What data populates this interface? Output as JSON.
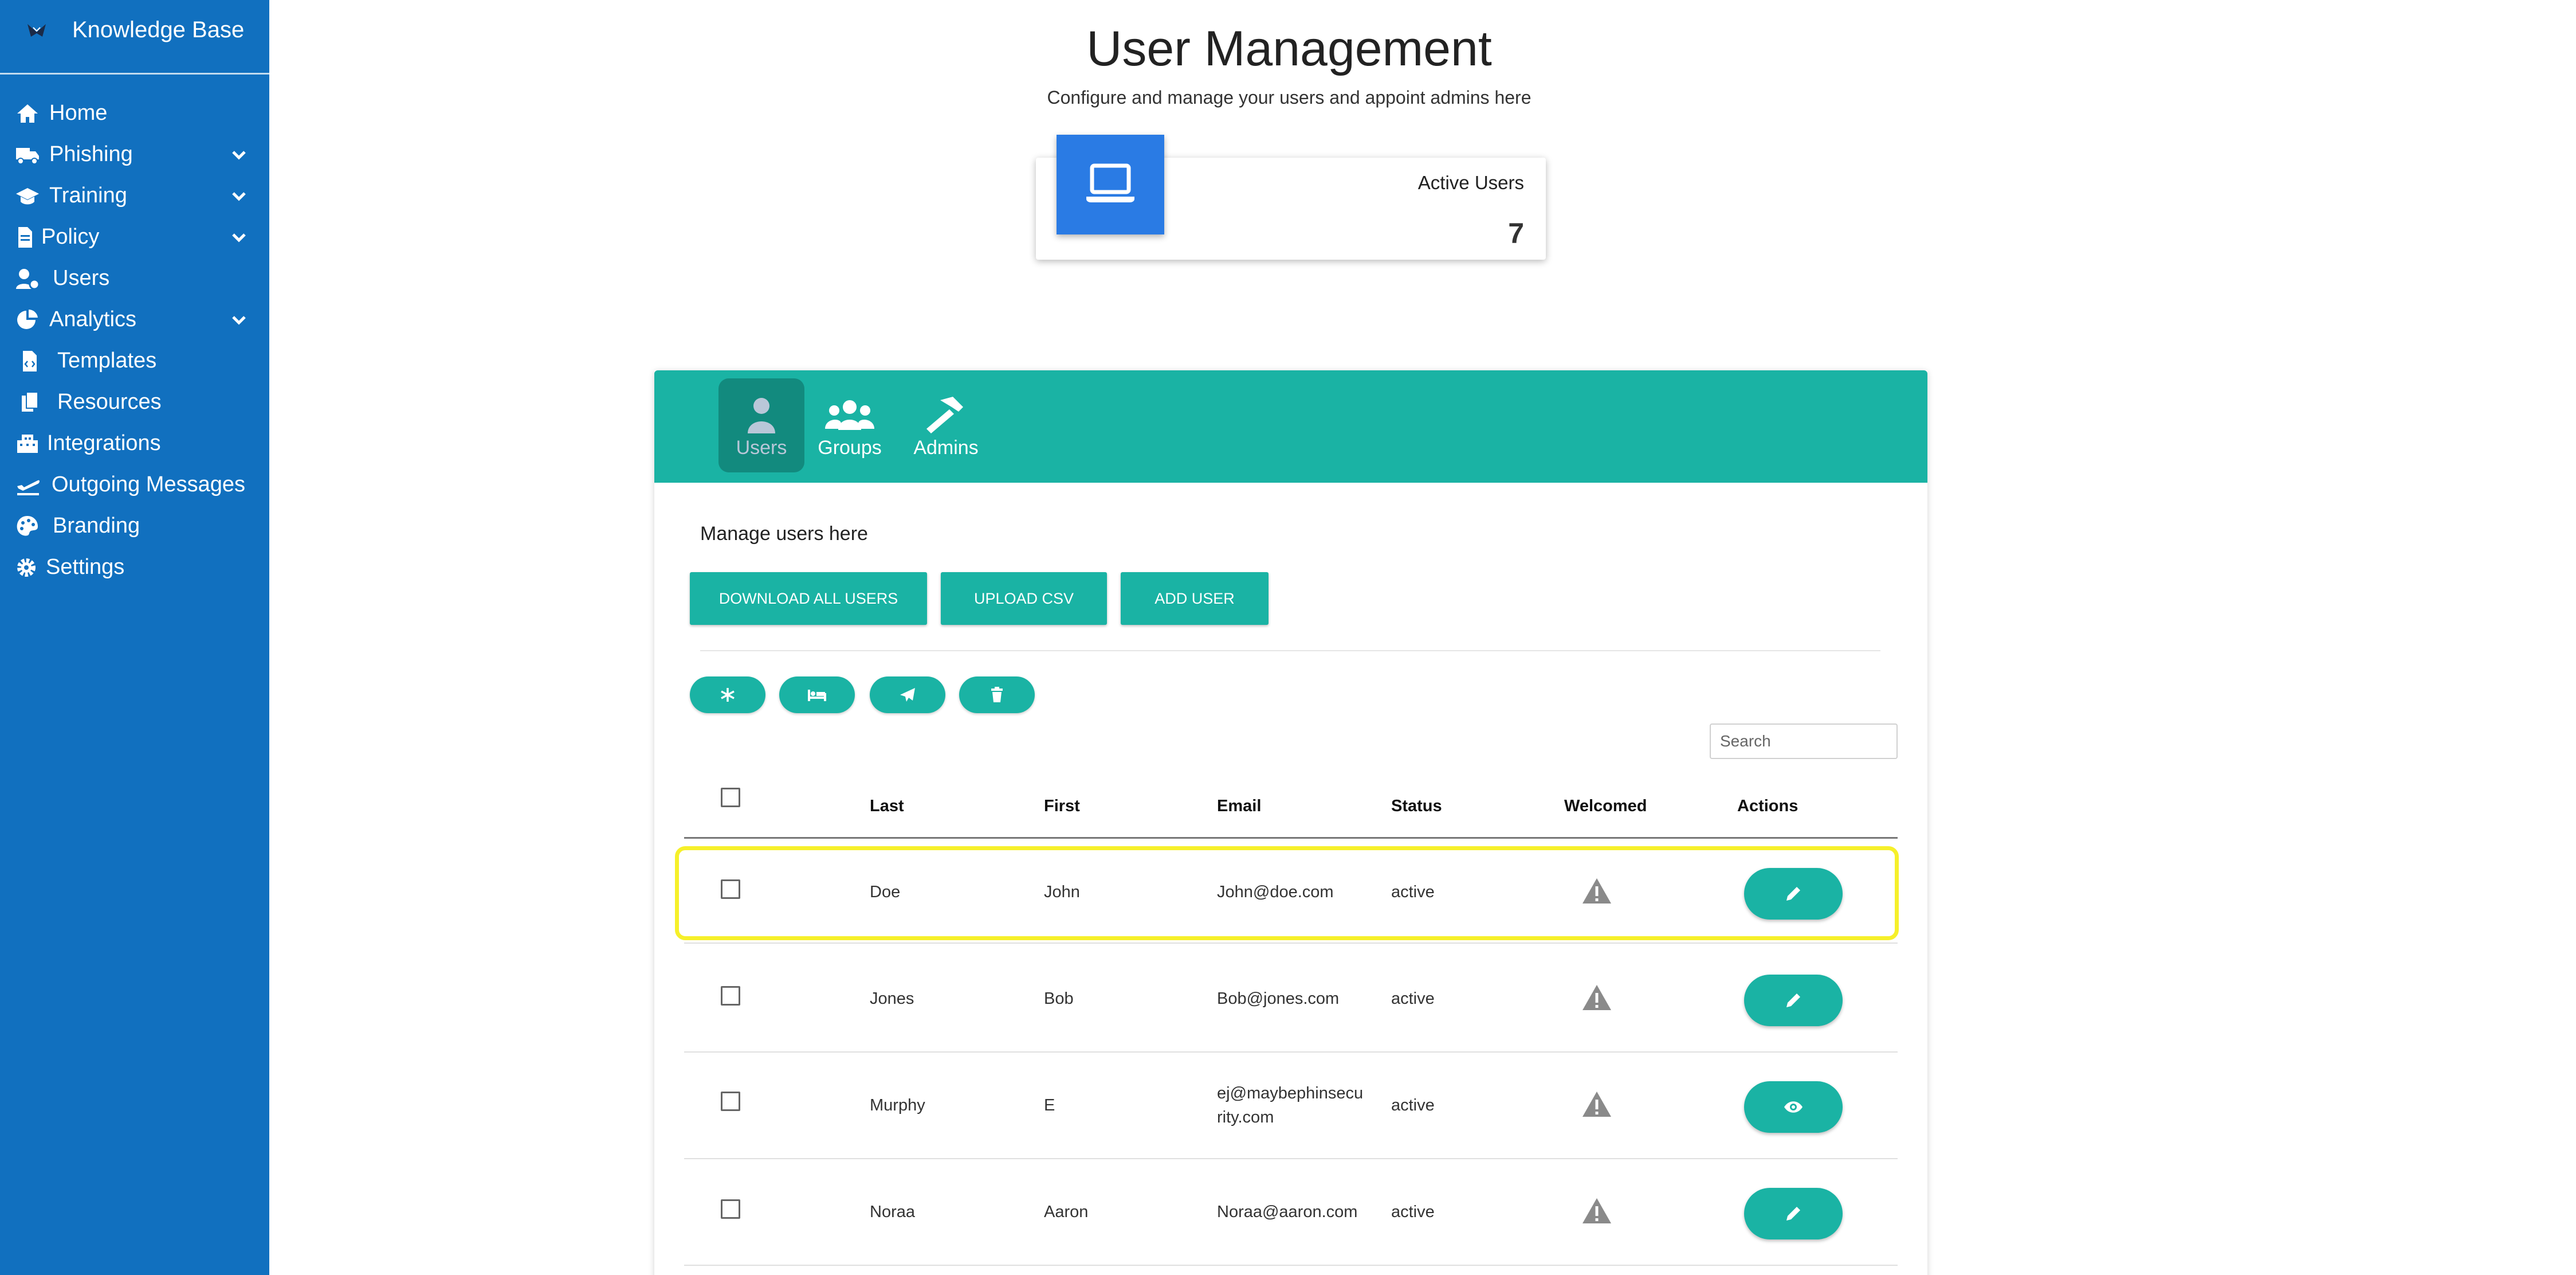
{
  "app": {
    "title": "Knowledge Base"
  },
  "sidebar": {
    "items": [
      {
        "label": "Home",
        "icon": "home-icon",
        "expandable": false
      },
      {
        "label": "Phishing",
        "icon": "truck-icon",
        "expandable": true
      },
      {
        "label": "Training",
        "icon": "graduation-cap-icon",
        "expandable": true
      },
      {
        "label": "Policy",
        "icon": "document-icon",
        "expandable": true
      },
      {
        "label": "Users",
        "icon": "user-gear-icon",
        "expandable": false
      },
      {
        "label": "Analytics",
        "icon": "pie-chart-icon",
        "expandable": true
      },
      {
        "label": "Templates",
        "icon": "code-file-icon",
        "expandable": false
      },
      {
        "label": "Resources",
        "icon": "copy-icon",
        "expandable": false
      },
      {
        "label": "Integrations",
        "icon": "building-icon",
        "expandable": false
      },
      {
        "label": "Outgoing Messages",
        "icon": "plane-departure-icon",
        "expandable": false
      },
      {
        "label": "Branding",
        "icon": "palette-icon",
        "expandable": false
      },
      {
        "label": "Settings",
        "icon": "gear-icon",
        "expandable": false
      }
    ]
  },
  "header": {
    "title": "User Management",
    "subtitle": "Configure and manage your users and appoint admins here"
  },
  "stat": {
    "label": "Active Users",
    "value": "7",
    "icon": "laptop-icon"
  },
  "tabs": [
    {
      "label": "Users",
      "icon": "user-icon",
      "active": true
    },
    {
      "label": "Groups",
      "icon": "users-icon",
      "active": false
    },
    {
      "label": "Admins",
      "icon": "hammer-icon",
      "active": false
    }
  ],
  "manage": {
    "text": "Manage users here",
    "download_label": "DOWNLOAD ALL USERS",
    "upload_label": "UPLOAD CSV",
    "add_label": "ADD USER"
  },
  "bulk_actions": [
    "snowflake-icon",
    "bed-icon",
    "paper-plane-icon",
    "trash-icon"
  ],
  "search": {
    "placeholder": "Search",
    "value": ""
  },
  "table": {
    "columns": [
      "Last",
      "First",
      "Email",
      "Status",
      "Welcomed",
      "Actions"
    ],
    "rows": [
      {
        "last": "Doe",
        "first": "John",
        "email": "John@doe.com",
        "status": "active",
        "welcomed_icon": "warning-icon",
        "action_icon": "pencil-icon",
        "highlighted": true
      },
      {
        "last": "Jones",
        "first": "Bob",
        "email": "Bob@jones.com",
        "status": "active",
        "welcomed_icon": "warning-icon",
        "action_icon": "pencil-icon",
        "highlighted": false
      },
      {
        "last": "Murphy",
        "first": "E",
        "email_line1": "ej@maybephinsecu",
        "email_line2": "rity.com",
        "status": "active",
        "welcomed_icon": "warning-icon",
        "action_icon": "eye-icon",
        "highlighted": false
      },
      {
        "last": "Noraa",
        "first": "Aaron",
        "email": "Noraa@aaron.com",
        "status": "active",
        "welcomed_icon": "warning-icon",
        "action_icon": "pencil-icon",
        "highlighted": false
      }
    ]
  },
  "colors": {
    "sidebar": "#1170bf",
    "teal": "#1ab3a4",
    "teal_dark": "#128a7e",
    "stat_icon_bg": "#2a7be4",
    "highlight": "#f6f02a",
    "warning_icon": "#8a8a8a"
  }
}
